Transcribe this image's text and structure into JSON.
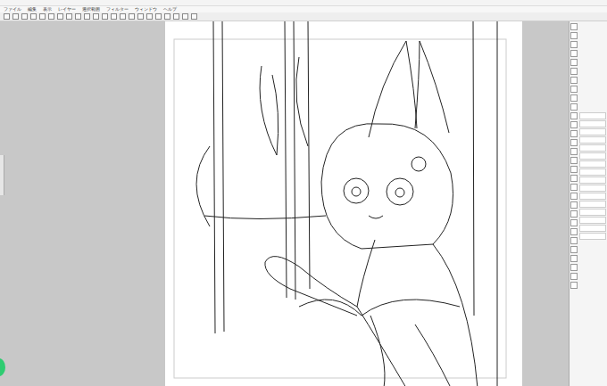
{
  "menu": [
    "ファイル",
    "編集",
    "表示",
    "レイヤー",
    "選択範囲",
    "フィルター",
    "ウィンドウ",
    "ヘルプ"
  ]
}
